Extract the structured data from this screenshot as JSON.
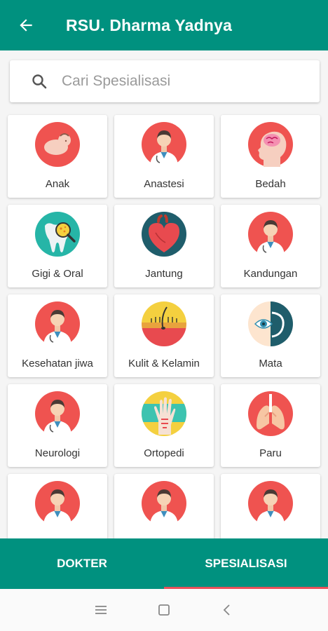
{
  "app_bar": {
    "title": "RSU. Dharma Yadnya",
    "back_icon": "arrow-left-icon"
  },
  "search": {
    "placeholder": "Cari Spesialisasi",
    "icon": "search-icon"
  },
  "colors": {
    "primary": "#00917f",
    "accent": "#e8515a",
    "icon_bg": "#ef5350"
  },
  "specializations": [
    {
      "label": "Anak",
      "icon": "baby-icon"
    },
    {
      "label": "Anastesi",
      "icon": "doctor-icon"
    },
    {
      "label": "Bedah",
      "icon": "brain-icon"
    },
    {
      "label": "Gigi & Oral",
      "icon": "tooth-icon"
    },
    {
      "label": "Jantung",
      "icon": "heart-icon"
    },
    {
      "label": "Kandungan",
      "icon": "doctor-icon"
    },
    {
      "label": "Kesehatan jiwa",
      "icon": "doctor-icon"
    },
    {
      "label": "Kulit & Kelamin",
      "icon": "skin-icon"
    },
    {
      "label": "Mata",
      "icon": "eye-icon"
    },
    {
      "label": "Neurologi",
      "icon": "doctor-icon"
    },
    {
      "label": "Ortopedi",
      "icon": "bone-icon"
    },
    {
      "label": "Paru",
      "icon": "lungs-icon"
    },
    {
      "label": "",
      "icon": "doctor-icon"
    },
    {
      "label": "",
      "icon": "doctor-icon"
    },
    {
      "label": "",
      "icon": "doctor-icon"
    }
  ],
  "tabs": [
    {
      "label": "DOKTER",
      "active": false
    },
    {
      "label": "SPESIALISASI",
      "active": true
    }
  ],
  "system_nav": {
    "menu_icon": "menu-icon",
    "home_icon": "home-icon",
    "back_icon": "back-chevron-icon"
  }
}
